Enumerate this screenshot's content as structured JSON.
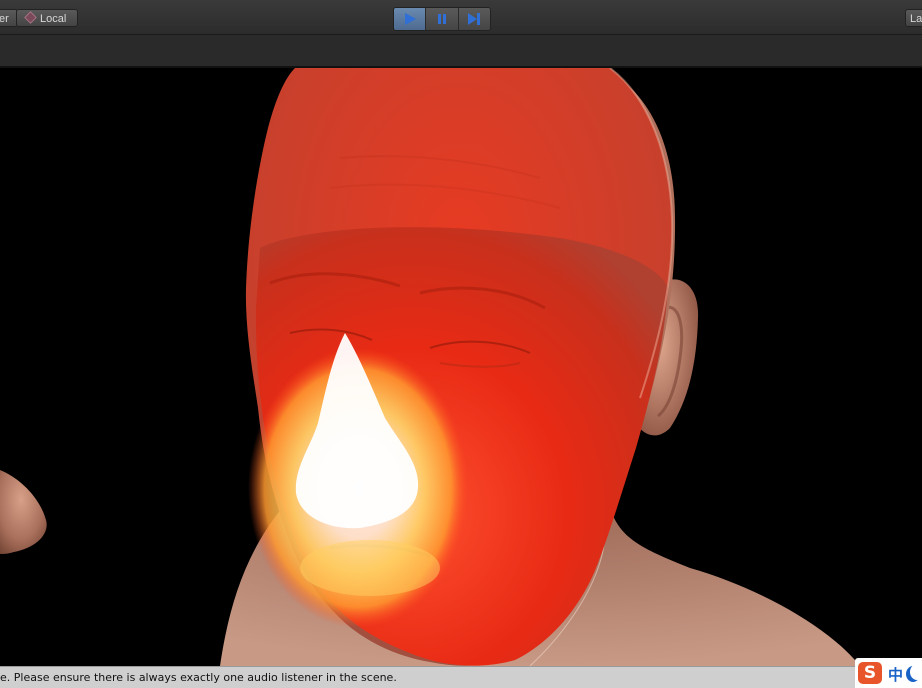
{
  "toolbar": {
    "pivot_label": "er",
    "space_label": "Local",
    "layers_label": "La",
    "play_icon": "play-icon",
    "pause_icon": "pause-icon",
    "step_icon": "step-icon",
    "play_active_color": "#6a8ab0",
    "icon_color": "#2f6fd6"
  },
  "scene": {
    "description_icon": "head-render",
    "glow_color": "#ff2a1a"
  },
  "status": {
    "message": "e. Please ensure there is always exactly one audio listener in the scene."
  },
  "ime": {
    "logo": "S",
    "lang": "中",
    "logo_color": "#e8552a",
    "accent_color": "#1a63c6"
  }
}
